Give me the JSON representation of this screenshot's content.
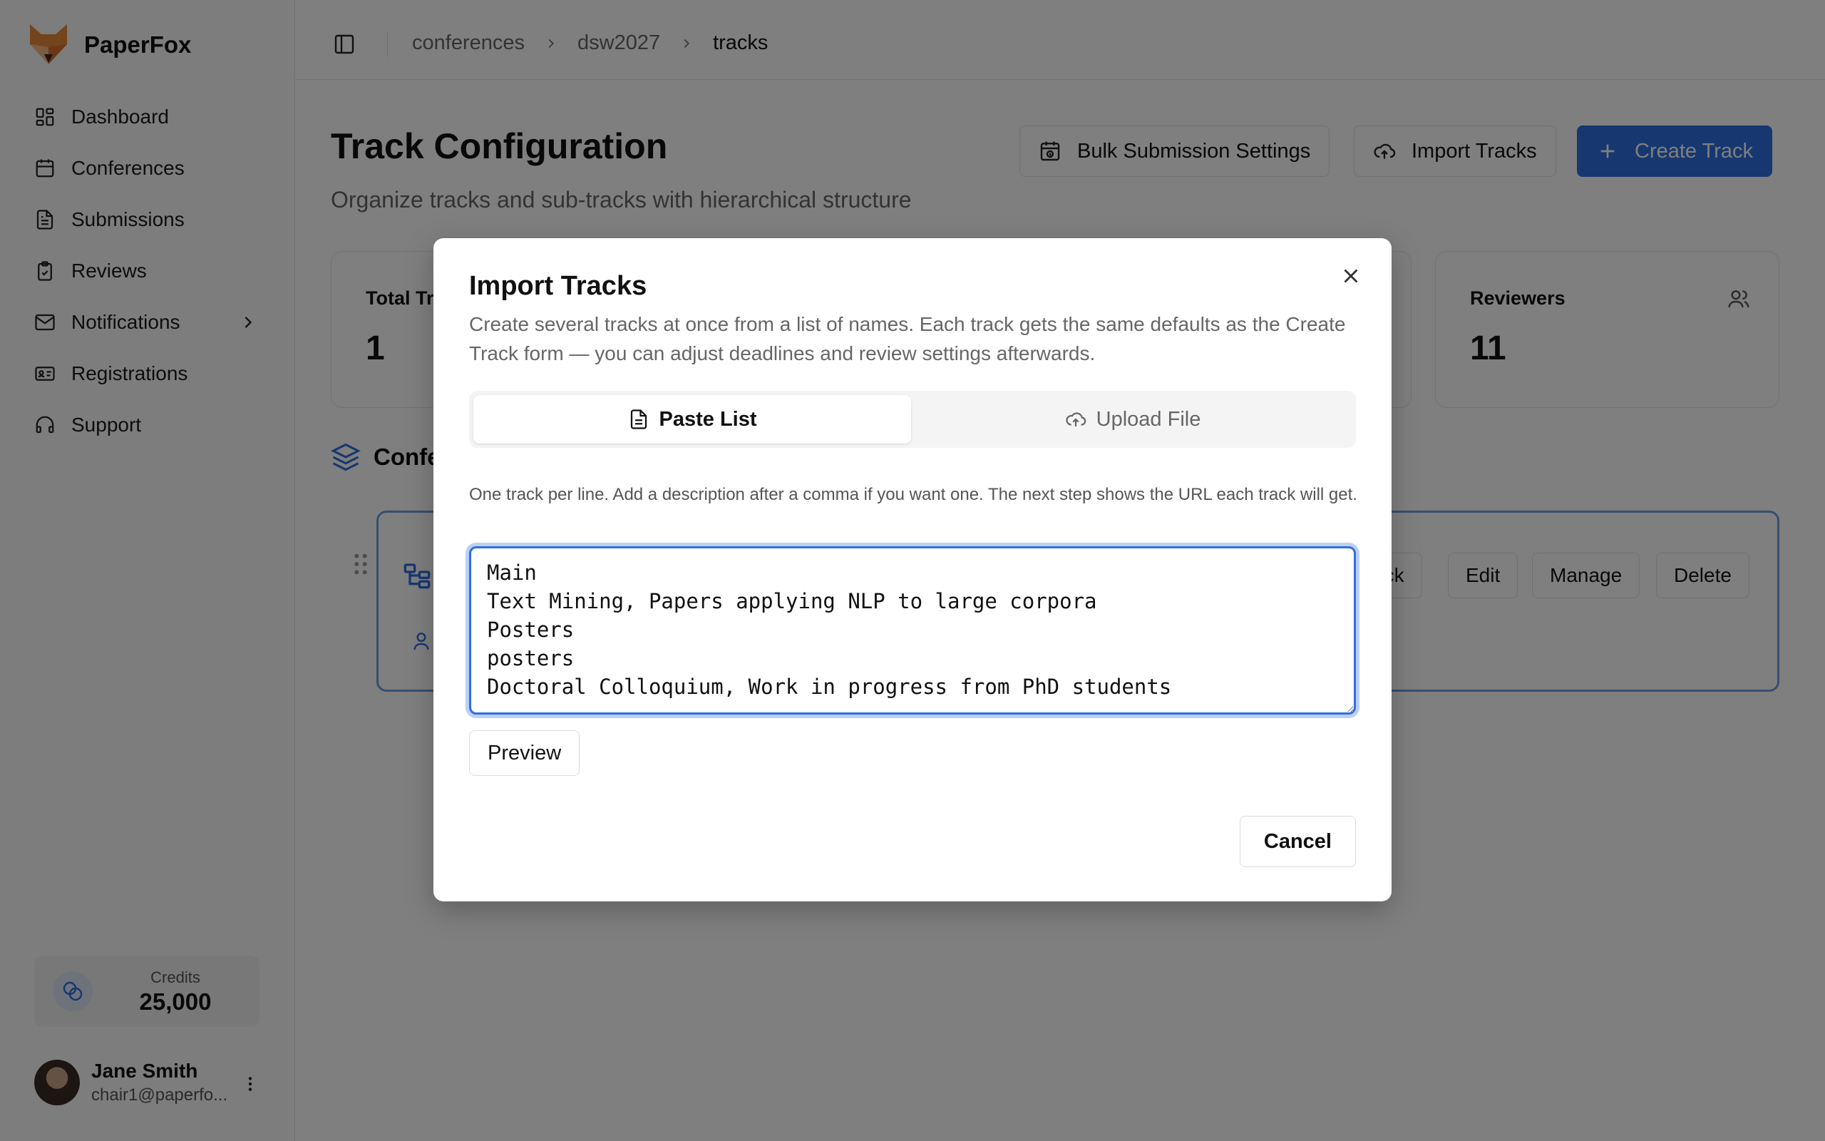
{
  "app": {
    "name": "PaperFox"
  },
  "sidebar": {
    "items": [
      {
        "label": "Dashboard",
        "icon": "dashboard-icon"
      },
      {
        "label": "Conferences",
        "icon": "calendar-icon"
      },
      {
        "label": "Submissions",
        "icon": "file-text-icon"
      },
      {
        "label": "Reviews",
        "icon": "clipboard-icon"
      },
      {
        "label": "Notifications",
        "icon": "mail-icon"
      },
      {
        "label": "Registrations",
        "icon": "id-card-icon"
      },
      {
        "label": "Support",
        "icon": "headset-icon"
      }
    ],
    "credits": {
      "label": "Credits",
      "value": "25,000"
    },
    "user": {
      "name": "Jane Smith",
      "email": "chair1@paperfo..."
    }
  },
  "breadcrumb": {
    "items": [
      "conferences",
      "dsw2027",
      "tracks"
    ]
  },
  "page": {
    "title": "Track Configuration",
    "subtitle": "Organize tracks and sub-tracks with hierarchical structure",
    "actions": {
      "bulk": "Bulk Submission Settings",
      "import": "Import Tracks",
      "create": "Create Track"
    },
    "stats": [
      {
        "label": "Total Tr",
        "value": "1"
      },
      {
        "label": "Reviewers",
        "value": "11"
      }
    ],
    "section_title": "Confe",
    "track_actions": {
      "sub": "ack",
      "edit": "Edit",
      "manage": "Manage",
      "delete": "Delete"
    }
  },
  "modal": {
    "title": "Import Tracks",
    "description": "Create several tracks at once from a list of names. Each track gets the same defaults as the Create Track form — you can adjust deadlines and review settings afterwards.",
    "tabs": [
      {
        "label": "Paste List",
        "active": true
      },
      {
        "label": "Upload File",
        "active": false
      }
    ],
    "hint": "One track per line. Add a description after a comma if you want one. The next step shows the URL each track will get.",
    "textarea_value": "Main\nText Mining, Papers applying NLP to large corpora\nPosters\nposters\nDoctoral Colloquium, Work in progress from PhD students",
    "preview_label": "Preview",
    "cancel_label": "Cancel"
  },
  "colors": {
    "accent": "#2f6fe0",
    "overlay": "rgba(0,0,0,0.5)"
  }
}
